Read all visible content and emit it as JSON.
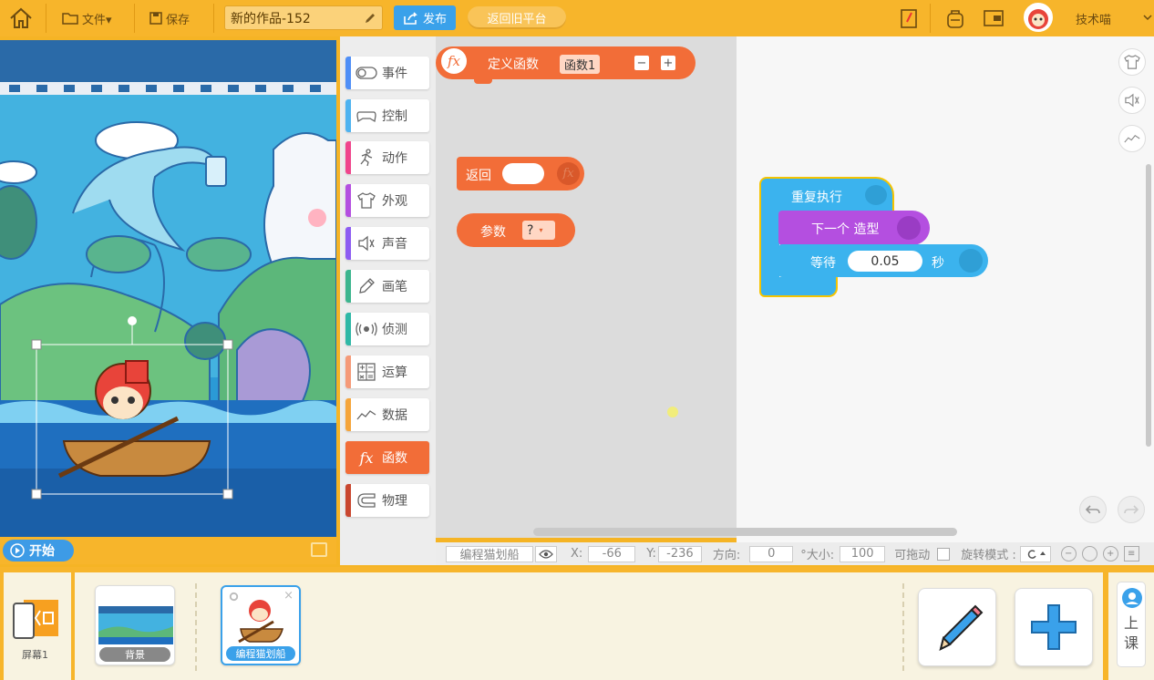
{
  "topbar": {
    "file_menu": "文件▾",
    "save": "保存",
    "project_title": "新的作品-152",
    "publish": "发布",
    "old_platform": "返回旧平台",
    "username": "技术喵"
  },
  "stage": {
    "start": "开始"
  },
  "categories": [
    {
      "label": "事件",
      "color": "#4f8ff7",
      "icon": "toggle-icon"
    },
    {
      "label": "控制",
      "color": "#4fb3f0",
      "icon": "gamepad-icon"
    },
    {
      "label": "动作",
      "color": "#f0458c",
      "icon": "runner-icon"
    },
    {
      "label": "外观",
      "color": "#b44fe0",
      "icon": "shirt-icon"
    },
    {
      "label": "声音",
      "color": "#8d5cf2",
      "icon": "speaker-icon"
    },
    {
      "label": "画笔",
      "color": "#3db58e",
      "icon": "pencil-icon"
    },
    {
      "label": "侦测",
      "color": "#2fb8a6",
      "icon": "sensor-icon"
    },
    {
      "label": "运算",
      "color": "#f59a78",
      "icon": "calculator-icon"
    },
    {
      "label": "数据",
      "color": "#f5a53a",
      "icon": "chart-icon"
    },
    {
      "label": "函数",
      "color": "#f26d38",
      "icon": "fx-icon"
    },
    {
      "label": "物理",
      "color": "#c9472f",
      "icon": "magnet-icon"
    }
  ],
  "palette": {
    "define_function": "定义函数",
    "function_name": "函数1",
    "minus": "−",
    "plus": "+",
    "return": "返回",
    "param": "参数",
    "param_value": "?"
  },
  "script": {
    "repeat": "重复执行",
    "next_costume": "下一个 造型",
    "wait": "等待",
    "wait_value": "0.05",
    "seconds": "秒"
  },
  "statusbar": {
    "sprite_name": "编程猫划船",
    "x_label": "X:",
    "x_value": "-66",
    "y_label": "Y:",
    "y_value": "-236",
    "direction_label": "方向:",
    "direction_value": "0",
    "size_label": "°大小:",
    "size_value": "100",
    "draggable_label": "可拖动",
    "rotation_label": "旋转模式 :"
  },
  "bottom": {
    "screen_label": "屏幕1",
    "sprites": [
      {
        "name": "背景"
      },
      {
        "name": "编程猫划船"
      }
    ],
    "class_label": "上课"
  },
  "colors": {
    "topbar": "#f7b52b",
    "function_block": "#f26d38",
    "control_block": "#3bb3ee",
    "looks_block": "#b44fe0",
    "publish": "#3aa1ea"
  }
}
